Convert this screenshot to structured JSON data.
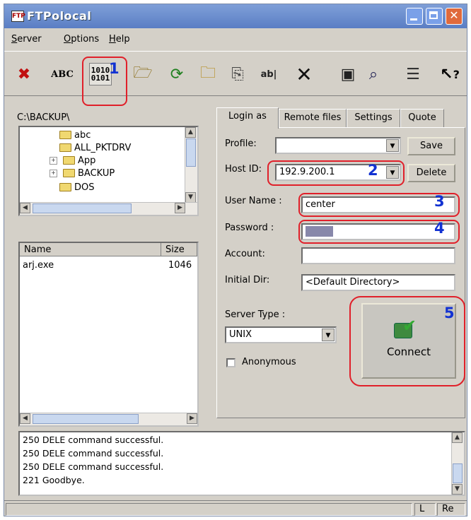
{
  "window": {
    "title": "FTPolocal"
  },
  "menu": [
    "Server",
    "Options",
    "Help"
  ],
  "toolbar": {
    "abc_label": "ABC",
    "binary_label_top": "1010",
    "binary_label_bottom": "0101",
    "help_label": "?",
    "icons": [
      "disconnect-icon",
      "ascii-mode-icon",
      "binary-mode-icon",
      "folder-link-icon",
      "refresh-icon",
      "new-folder-icon",
      "copy-icon",
      "rename-icon",
      "delete-icon",
      "save-icon",
      "find-icon",
      "properties-icon",
      "help-icon"
    ]
  },
  "callouts": [
    "1",
    "2",
    "3",
    "4",
    "5"
  ],
  "local": {
    "path": "C:\\BACKUP\\",
    "tree": [
      {
        "label": "abc",
        "expandable": false
      },
      {
        "label": "ALL_PKTDRV",
        "expandable": false
      },
      {
        "label": "App",
        "expandable": true
      },
      {
        "label": "BACKUP",
        "expandable": true
      },
      {
        "label": "DOS",
        "expandable": false
      }
    ],
    "columns": [
      "Name",
      "Size"
    ],
    "files": [
      {
        "name": "arj.exe",
        "size": "1046"
      }
    ]
  },
  "tabs": [
    "Login as",
    "Remote files",
    "Settings",
    "Quote"
  ],
  "login": {
    "profile_label": "Profile:",
    "profile_value": "",
    "save_label": "Save",
    "host_label": "Host ID:",
    "host_value": "192.9.200.1",
    "delete_label": "Delete",
    "user_label": "User Name :",
    "user_value": "center",
    "password_label": "Password :",
    "password_value": "******",
    "account_label": "Account:",
    "account_value": "",
    "initdir_label": "Initial Dir:",
    "initdir_value": "<Default Directory>",
    "servertype_label": "Server Type :",
    "servertype_value": "UNIX",
    "anonymous_label": "Anonymous",
    "anonymous_checked": false,
    "connect_label": "Connect"
  },
  "log": [
    "250 DELE command successful.",
    "250 DELE command successful.",
    "250 DELE command successful.",
    "221 Goodbye."
  ],
  "status": {
    "panel1": "L",
    "panel2": "Re"
  },
  "colors": {
    "titlebar": "#6a8ed0",
    "callout_box": "#e0202a",
    "callout_number": "#1232d2"
  }
}
